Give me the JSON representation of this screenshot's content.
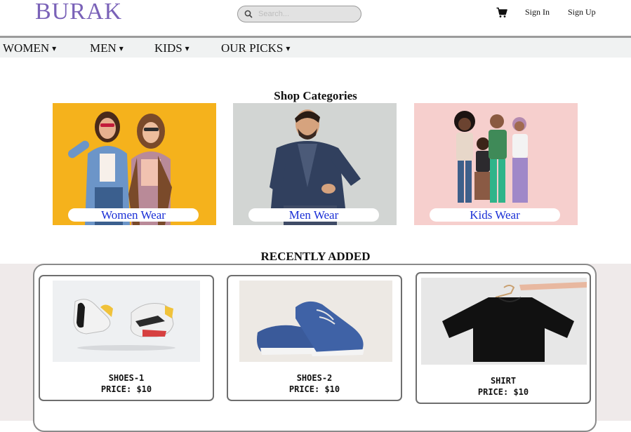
{
  "header": {
    "brand": "BURAK",
    "search_placeholder": "Search...",
    "sign_in": "Sign In",
    "sign_up": "Sign Up"
  },
  "nav": {
    "items": [
      {
        "label": "WOMEN"
      },
      {
        "label": "MEN"
      },
      {
        "label": "KIDS"
      },
      {
        "label": "OUR PICKS"
      }
    ],
    "caret": "▾"
  },
  "categories": {
    "title": "Shop Categories",
    "items": [
      {
        "label": "Women Wear",
        "bg": "#f5b21c"
      },
      {
        "label": "Men Wear",
        "bg": "#d2d5d3"
      },
      {
        "label": "Kids Wear",
        "bg": "#f6cfcd"
      }
    ]
  },
  "recent": {
    "title": "RECENTLY ADDED",
    "products": [
      {
        "name": "SHOES-1",
        "price": "PRICE: $10"
      },
      {
        "name": "SHOES-2",
        "price": "PRICE: $10"
      },
      {
        "name": "SHIRT",
        "price": "PRICE: $10"
      }
    ]
  },
  "colors": {
    "brand": "#7a62b8",
    "category_label_text": "#1a2fd6",
    "navbar_bg": "#f0f2f2",
    "recent_band_bg": "#efeaea"
  }
}
